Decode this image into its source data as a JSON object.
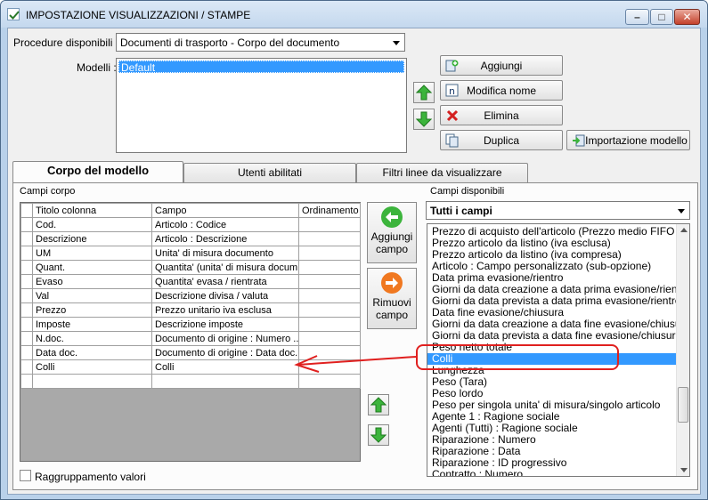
{
  "window": {
    "title": "IMPOSTAZIONE VISUALIZZAZIONI / STAMPE",
    "minimize_glyph": "–",
    "maximize_glyph": "□",
    "close_glyph": "✕"
  },
  "header": {
    "procedure_label": "Procedure disponibili :",
    "procedure_value": "Documenti di trasporto - Corpo del documento",
    "modelli_label": "Modelli :",
    "modelli": [
      "Default"
    ],
    "buttons": {
      "aggiungi": "Aggiungi",
      "modifica_nome": "Modifica nome",
      "elimina": "Elimina",
      "duplica": "Duplica",
      "importazione_modello": "Importazione modello"
    }
  },
  "tabs": [
    {
      "label": "Corpo del modello",
      "active": true
    },
    {
      "label": "Utenti abilitati",
      "active": false
    },
    {
      "label": "Filtri linee da visualizzare",
      "active": false
    }
  ],
  "campi_corpo": {
    "label": "Campi corpo",
    "columns": [
      "Titolo colonna",
      "Campo",
      "Ordinamento"
    ],
    "rows": [
      {
        "titolo": "Cod.",
        "campo": "Articolo : Codice",
        "ordinamento": ""
      },
      {
        "titolo": "Descrizione",
        "campo": "Articolo : Descrizione",
        "ordinamento": ""
      },
      {
        "titolo": "UM",
        "campo": "Unita' di misura documento",
        "ordinamento": ""
      },
      {
        "titolo": "Quant.",
        "campo": "Quantita' (unita' di misura docum...",
        "ordinamento": ""
      },
      {
        "titolo": "Evaso",
        "campo": "Quantita' evasa / rientrata",
        "ordinamento": ""
      },
      {
        "titolo": "Val",
        "campo": "Descrizione divisa / valuta",
        "ordinamento": ""
      },
      {
        "titolo": "Prezzo",
        "campo": "Prezzo unitario iva esclusa",
        "ordinamento": ""
      },
      {
        "titolo": "Imposte",
        "campo": "Descrizione imposte",
        "ordinamento": ""
      },
      {
        "titolo": "N.doc.",
        "campo": "Documento di origine : Numero ...",
        "ordinamento": ""
      },
      {
        "titolo": "Data doc.",
        "campo": "Documento di origine : Data doc.",
        "ordinamento": ""
      },
      {
        "titolo": "Colli",
        "campo": "Colli",
        "ordinamento": ""
      },
      {
        "titolo": "",
        "campo": "",
        "ordinamento": ""
      }
    ]
  },
  "actions": {
    "aggiungi_campo": [
      "Aggiungi",
      "campo"
    ],
    "rimuovi_campo": [
      "Rimuovi",
      "campo"
    ]
  },
  "campi_disponibili": {
    "label": "Campi disponibili",
    "filter_value": "Tutti i campi",
    "items": [
      "Prezzo di acquisto dell'articolo (Prezzo medio FIFO calcola",
      "Prezzo articolo da listino (iva esclusa)",
      "Prezzo articolo da listino (iva compresa)",
      "Articolo : Campo personalizzato (sub-opzione)",
      "Data prima evasione/rientro",
      "Giorni da data creazione a data prima evasione/rientro",
      "Giorni da data prevista a data prima evasione/rientro",
      "Data fine evasione/chiusura",
      "Giorni da data creazione a data fine evasione/chiusura",
      "Giorni da data prevista a data fine evasione/chiusura",
      "Peso netto totale",
      "Colli",
      "Lunghezza",
      "Peso (Tara)",
      "Peso lordo",
      "Peso per singola unita' di misura/singolo articolo",
      "Agente 1 : Ragione sociale",
      "Agenti (Tutti) : Ragione sociale",
      "Riparazione : Numero",
      "Riparazione : Data",
      "Riparazione : ID progressivo",
      "Contratto : Numero"
    ],
    "selected_index": 11
  },
  "raggruppamento_label": "Raggruppamento valori",
  "colors": {
    "selection": "#3399ff",
    "annotation": "#e0201f",
    "arrow_green": "#3cb43c",
    "arrow_orange": "#f07820"
  }
}
